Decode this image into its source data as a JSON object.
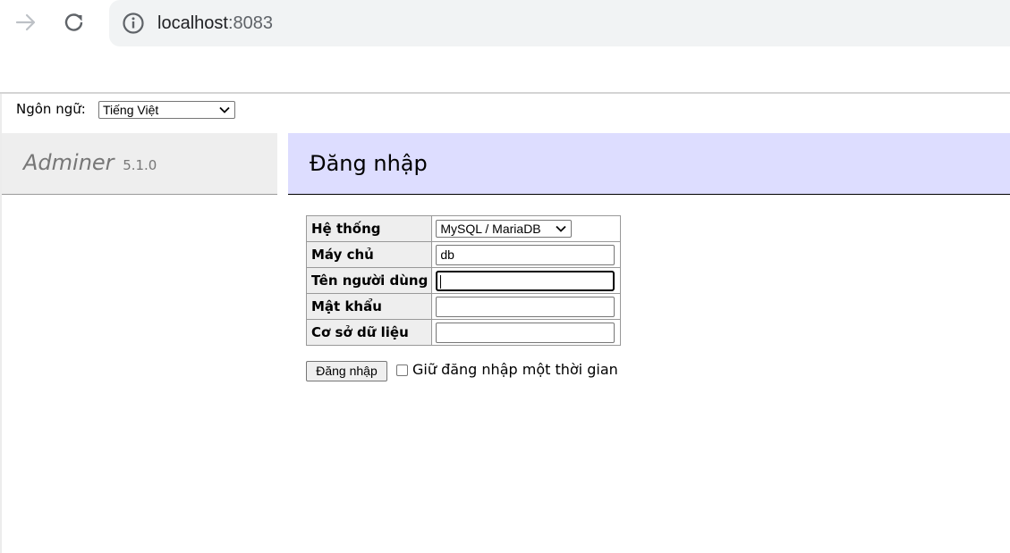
{
  "browser": {
    "url_host": "localhost",
    "url_port": ":8083",
    "icons": [
      "forward-icon",
      "reload-icon",
      "info-icon"
    ]
  },
  "language": {
    "label": "Ngôn ngữ:",
    "selected": "Tiếng Việt"
  },
  "menu": {
    "brand": "Adminer",
    "version": "5.1.0"
  },
  "content": {
    "title": "Đăng nhập"
  },
  "login_form": {
    "system_label": "Hệ thống",
    "system_value": "MySQL / MariaDB",
    "server_label": "Máy chủ",
    "server_value": "db",
    "username_label": "Tên người dùng",
    "username_value": "",
    "password_label": "Mật khẩu",
    "password_value": "",
    "database_label": "Cơ sở dữ liệu",
    "database_value": "",
    "submit_label": "Đăng nhập",
    "permanent_label": "Giữ đăng nhập một thời gian",
    "permanent_checked": false
  }
}
